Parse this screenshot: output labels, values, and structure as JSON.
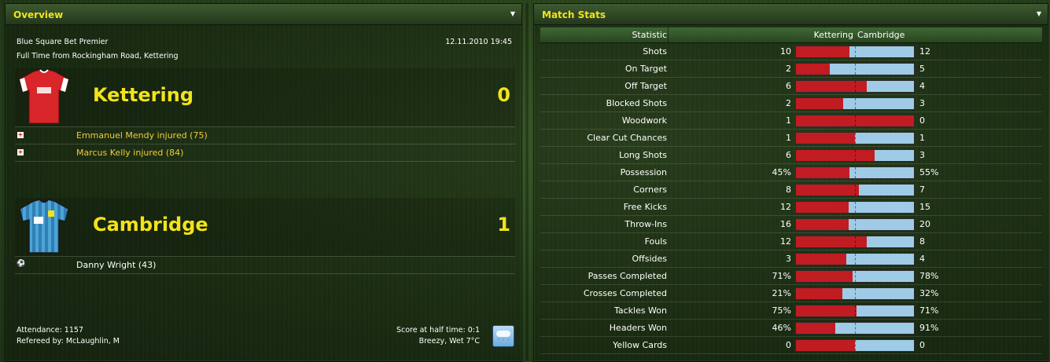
{
  "overview": {
    "title": "Overview",
    "competition": "Blue Square Bet Premier",
    "datetime": "12.11.2010 19:45",
    "venue_line": "Full Time from Rockingham Road, Kettering",
    "home": {
      "name": "Kettering",
      "score": "0",
      "kit_colors": {
        "main": "#d8262a",
        "trim": "#ffffff"
      },
      "events": [
        {
          "type": "injury",
          "icon": "injury-icon",
          "text": "Emmanuel Mendy injured (75)"
        },
        {
          "type": "injury",
          "icon": "injury-icon",
          "text": "Marcus Kelly injured (84)"
        }
      ]
    },
    "away": {
      "name": "Cambridge",
      "score": "1",
      "kit_colors": {
        "main": "#4ea4d6",
        "trim": "#1a1a1a"
      },
      "events": [
        {
          "type": "goal",
          "icon": "ball-icon",
          "text": "Danny Wright (43)"
        }
      ]
    },
    "attendance": "Attendance: 1157",
    "referee": "Refereed by: McLaughlin, M",
    "half_time": "Score at half time: 0:1",
    "weather": "Breezy, Wet 7°C",
    "weather_icon": "rain-cloud-icon"
  },
  "match_stats": {
    "title": "Match Stats",
    "columns": {
      "statistic": "Statistic",
      "home": "Kettering",
      "away": "Cambridge"
    },
    "colors": {
      "home_bar": "#c11c22",
      "away_bar": "#9fcbe6"
    },
    "rows": [
      {
        "label": "Shots",
        "home": "10",
        "away": "12",
        "home_share": 0.455
      },
      {
        "label": "On Target",
        "home": "2",
        "away": "5",
        "home_share": 0.286
      },
      {
        "label": "Off Target",
        "home": "6",
        "away": "4",
        "home_share": 0.6
      },
      {
        "label": "Blocked Shots",
        "home": "2",
        "away": "3",
        "home_share": 0.4
      },
      {
        "label": "Woodwork",
        "home": "1",
        "away": "0",
        "home_share": 1.0
      },
      {
        "label": "Clear Cut Chances",
        "home": "1",
        "away": "1",
        "home_share": 0.5
      },
      {
        "label": "Long Shots",
        "home": "6",
        "away": "3",
        "home_share": 0.667
      },
      {
        "label": "Possession",
        "home": "45%",
        "away": "55%",
        "home_share": 0.45
      },
      {
        "label": "Corners",
        "home": "8",
        "away": "7",
        "home_share": 0.533
      },
      {
        "label": "Free Kicks",
        "home": "12",
        "away": "15",
        "home_share": 0.444
      },
      {
        "label": "Throw-Ins",
        "home": "16",
        "away": "20",
        "home_share": 0.444
      },
      {
        "label": "Fouls",
        "home": "12",
        "away": "8",
        "home_share": 0.6
      },
      {
        "label": "Offsides",
        "home": "3",
        "away": "4",
        "home_share": 0.429
      },
      {
        "label": "Passes Completed",
        "home": "71%",
        "away": "78%",
        "home_share": 0.477
      },
      {
        "label": "Crosses Completed",
        "home": "21%",
        "away": "32%",
        "home_share": 0.396
      },
      {
        "label": "Tackles Won",
        "home": "75%",
        "away": "71%",
        "home_share": 0.514
      },
      {
        "label": "Headers Won",
        "home": "46%",
        "away": "91%",
        "home_share": 0.336
      },
      {
        "label": "Yellow Cards",
        "home": "0",
        "away": "0",
        "home_share": 0.5
      }
    ]
  }
}
